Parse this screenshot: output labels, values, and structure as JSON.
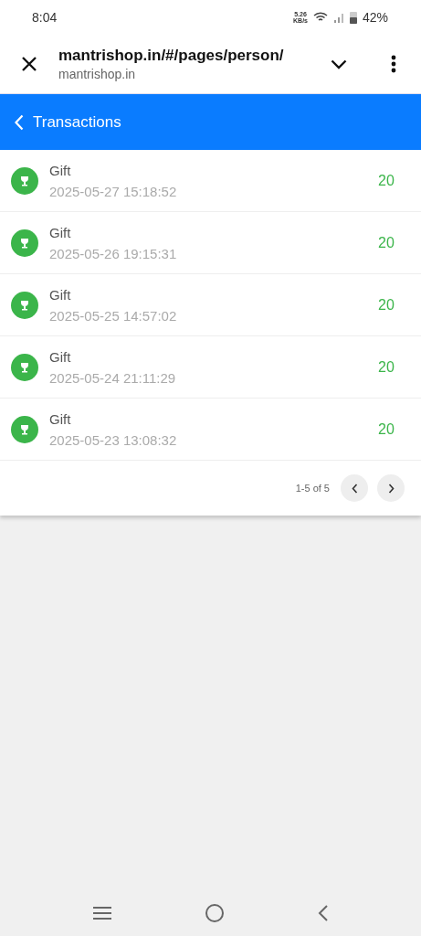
{
  "status_bar": {
    "time": "8:04",
    "speed": "5.26",
    "speed_unit": "KB/s",
    "battery": "42%"
  },
  "browser": {
    "url": "mantrishop.in/#/pages/person/",
    "domain": "mantrishop.in"
  },
  "header": {
    "title": "Transactions"
  },
  "transactions": [
    {
      "title": "Gift",
      "time": "2025-05-27 15:18:52",
      "amount": "20"
    },
    {
      "title": "Gift",
      "time": "2025-05-26 19:15:31",
      "amount": "20"
    },
    {
      "title": "Gift",
      "time": "2025-05-25 14:57:02",
      "amount": "20"
    },
    {
      "title": "Gift",
      "time": "2025-05-24 21:11:29",
      "amount": "20"
    },
    {
      "title": "Gift",
      "time": "2025-05-23 13:08:32",
      "amount": "20"
    }
  ],
  "pagination": {
    "range": "1-5 of 5"
  }
}
